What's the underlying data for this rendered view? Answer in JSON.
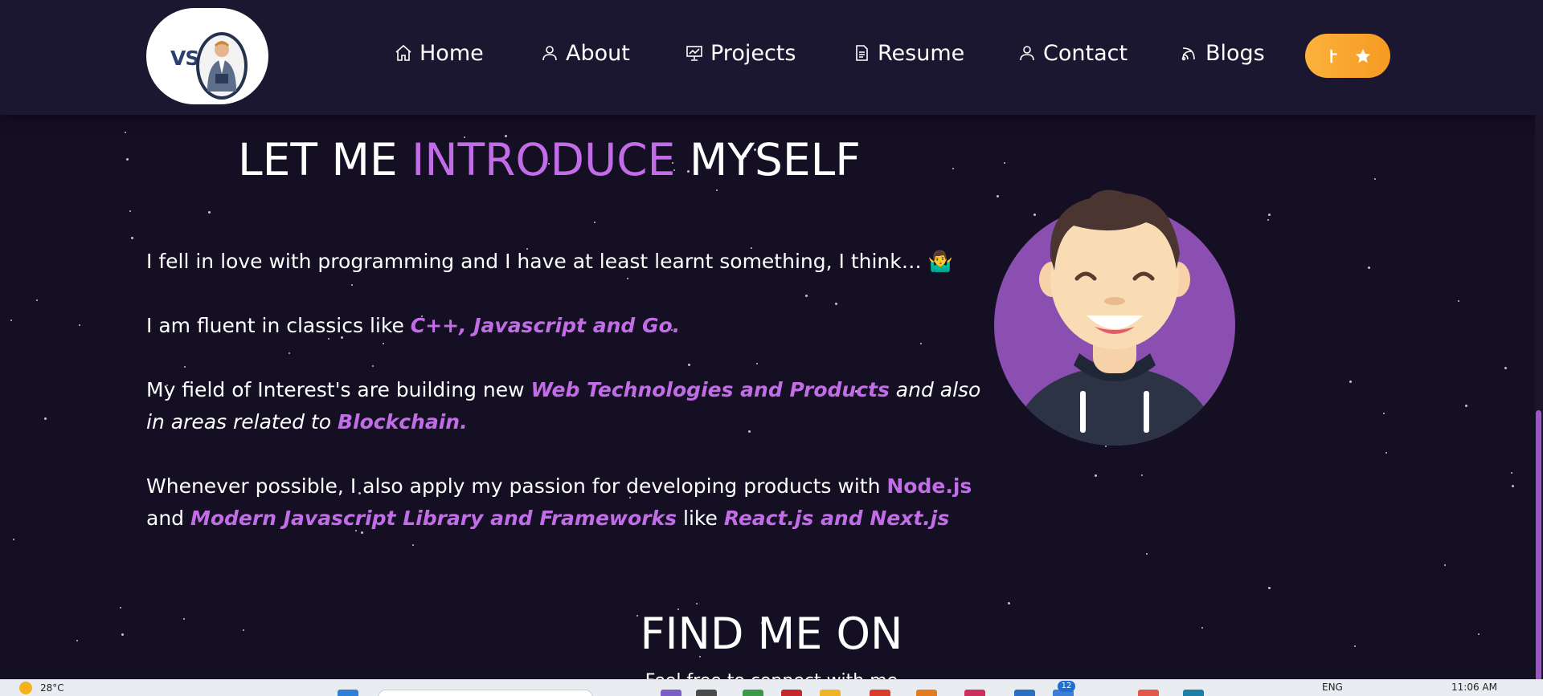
{
  "nav": {
    "logo_text": "VS.",
    "items": [
      {
        "label": "Home",
        "icon": "home-icon"
      },
      {
        "label": "About",
        "icon": "user-icon"
      },
      {
        "label": "Projects",
        "icon": "presentation-icon"
      },
      {
        "label": "Resume",
        "icon": "document-icon"
      },
      {
        "label": "Contact",
        "icon": "user-icon"
      },
      {
        "label": "Blogs",
        "icon": "feed-icon"
      }
    ],
    "github_button_icons": [
      "git-fork-icon",
      "star-icon"
    ]
  },
  "about": {
    "title_part1": "LET ME ",
    "title_highlight": "INTRODUCE",
    "title_part2": " MYSELF",
    "p1": "I fell in love with programming and I have at least learnt something, I think… 🤷‍♂️",
    "p2_text": "I am fluent in classics like ",
    "p2_highlight": "C++, Javascript and Go.",
    "p3_text": "My field of Interest's are building new ",
    "p3_highlight": "Web Technologies and Products",
    "p3_italic": " and also in areas related to ",
    "p3_highlight2": "Blockchain.",
    "p4_text": "Whenever possible, I also apply my passion for developing products with ",
    "p4_highlight": "Node.js",
    "p4_and": " and ",
    "p4_highlight2": "Modern Javascript Library and Frameworks",
    "p4_like": "  like ",
    "p4_highlight3": "React.js and Next.js"
  },
  "find": {
    "title": "FIND ME ON",
    "subtitle": "Feel free to connect with me"
  },
  "taskbar": {
    "weather": "28°C",
    "lang": "ENG",
    "time": "11:06 AM",
    "badge": "12"
  },
  "colors": {
    "background": "#150f24",
    "navbar": "#1b1730",
    "accent": "#c36ce8",
    "button": "#f5a623",
    "avatar_bg": "#8a4fb0"
  }
}
